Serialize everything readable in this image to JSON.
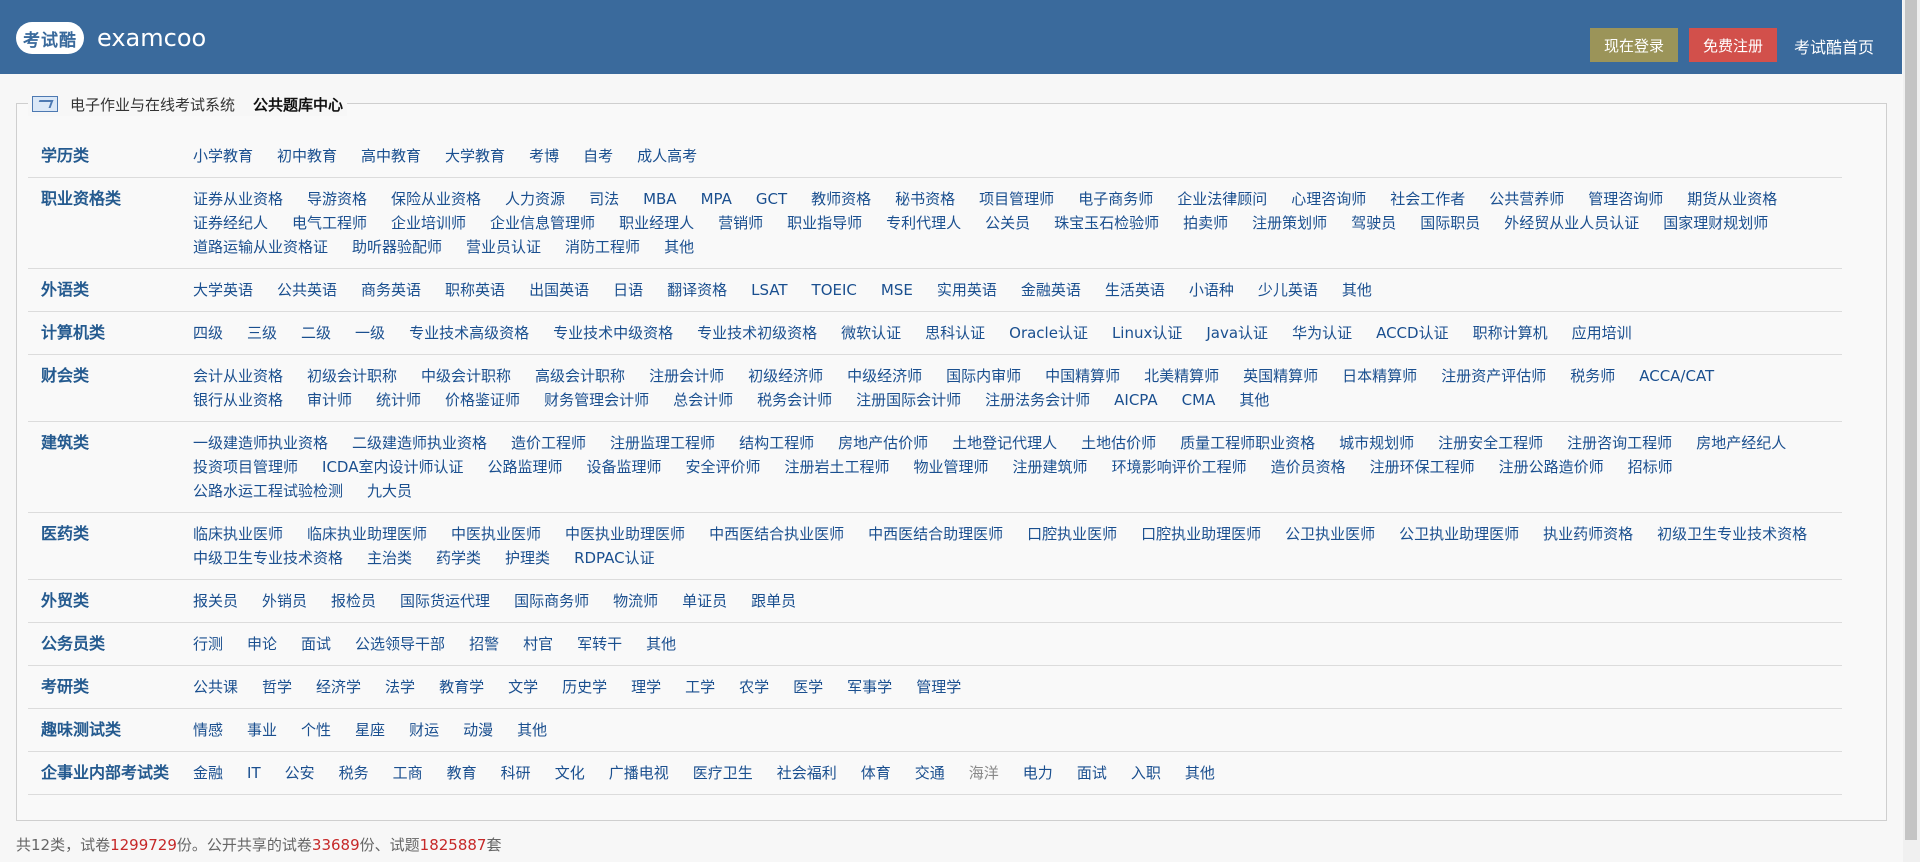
{
  "header": {
    "logo_badge": "考试酷",
    "logo_text": "examcoo",
    "login_label": "现在登录",
    "register_label": "免费注册",
    "home_label": "考试酷首页"
  },
  "legend": {
    "system_link": "电子作业与在线考试系统",
    "title": "公共题库中心"
  },
  "categories": [
    {
      "label": "学历类",
      "items": [
        "小学教育",
        "初中教育",
        "高中教育",
        "大学教育",
        "考博",
        "自考",
        "成人高考"
      ]
    },
    {
      "label": "职业资格类",
      "items": [
        "证券从业资格",
        "导游资格",
        "保险从业资格",
        "人力资源",
        "司法",
        "MBA",
        "MPA",
        "GCT",
        "教师资格",
        "秘书资格",
        "项目管理师",
        "电子商务师",
        "企业法律顾问",
        "心理咨询师",
        "社会工作者",
        "公共营养师",
        "管理咨询师",
        "期货从业资格",
        "证券经纪人",
        "电气工程师",
        "企业培训师",
        "企业信息管理师",
        "职业经理人",
        "营销师",
        "职业指导师",
        "专利代理人",
        "公关员",
        "珠宝玉石检验师",
        "拍卖师",
        "注册策划师",
        "驾驶员",
        "国际职员",
        "外经贸从业人员认证",
        "国家理财规划师",
        "道路运输从业资格证",
        "助听器验配师",
        "营业员认证",
        "消防工程师",
        "其他"
      ]
    },
    {
      "label": "外语类",
      "items": [
        "大学英语",
        "公共英语",
        "商务英语",
        "职称英语",
        "出国英语",
        "日语",
        "翻译资格",
        "LSAT",
        "TOEIC",
        "MSE",
        "实用英语",
        "金融英语",
        "生活英语",
        "小语种",
        "少儿英语",
        "其他"
      ]
    },
    {
      "label": "计算机类",
      "items": [
        "四级",
        "三级",
        "二级",
        "一级",
        "专业技术高级资格",
        "专业技术中级资格",
        "专业技术初级资格",
        "微软认证",
        "思科认证",
        "Oracle认证",
        "Linux认证",
        "Java认证",
        "华为认证",
        "ACCD认证",
        "职称计算机",
        "应用培训"
      ]
    },
    {
      "label": "财会类",
      "items": [
        "会计从业资格",
        "初级会计职称",
        "中级会计职称",
        "高级会计职称",
        "注册会计师",
        "初级经济师",
        "中级经济师",
        "国际内审师",
        "中国精算师",
        "北美精算师",
        "英国精算师",
        "日本精算师",
        "注册资产评估师",
        "税务师",
        "ACCA/CAT",
        "银行从业资格",
        "审计师",
        "统计师",
        "价格鉴证师",
        "财务管理会计师",
        "总会计师",
        "税务会计师",
        "注册国际会计师",
        "注册法务会计师",
        "AICPA",
        "CMA",
        "其他"
      ]
    },
    {
      "label": "建筑类",
      "items": [
        "一级建造师执业资格",
        "二级建造师执业资格",
        "造价工程师",
        "注册监理工程师",
        "结构工程师",
        "房地产估价师",
        "土地登记代理人",
        "土地估价师",
        "质量工程师职业资格",
        "城市规划师",
        "注册安全工程师",
        "注册咨询工程师",
        "房地产经纪人",
        "投资项目管理师",
        "ICDA室内设计师认证",
        "公路监理师",
        "设备监理师",
        "安全评价师",
        "注册岩土工程师",
        "物业管理师",
        "注册建筑师",
        "环境影响评价工程师",
        "造价员资格",
        "注册环保工程师",
        "注册公路造价师",
        "招标师",
        "公路水运工程试验检测",
        "九大员"
      ]
    },
    {
      "label": "医药类",
      "items": [
        "临床执业医师",
        "临床执业助理医师",
        "中医执业医师",
        "中医执业助理医师",
        "中西医结合执业医师",
        "中西医结合助理医师",
        "口腔执业医师",
        "口腔执业助理医师",
        "公卫执业医师",
        "公卫执业助理医师",
        "执业药师资格",
        "初级卫生专业技术资格",
        "中级卫生专业技术资格",
        "主治类",
        "药学类",
        "护理类",
        "RDPAC认证"
      ]
    },
    {
      "label": "外贸类",
      "items": [
        "报关员",
        "外销员",
        "报检员",
        "国际货运代理",
        "国际商务师",
        "物流师",
        "单证员",
        "跟单员"
      ]
    },
    {
      "label": "公务员类",
      "items": [
        "行测",
        "申论",
        "面试",
        "公选领导干部",
        "招警",
        "村官",
        "军转干",
        "其他"
      ]
    },
    {
      "label": "考研类",
      "items": [
        "公共课",
        "哲学",
        "经济学",
        "法学",
        "教育学",
        "文学",
        "历史学",
        "理学",
        "工学",
        "农学",
        "医学",
        "军事学",
        "管理学"
      ]
    },
    {
      "label": "趣味测试类",
      "items": [
        "情感",
        "事业",
        "个性",
        "星座",
        "财运",
        "动漫",
        "其他"
      ]
    },
    {
      "label": "企事业内部考试类",
      "items": [
        "金融",
        "IT",
        "公安",
        "税务",
        "工商",
        "教育",
        "科研",
        "文化",
        "广播电视",
        "医疗卫生",
        "社会福利",
        "体育",
        "交通",
        "海洋",
        "电力",
        "面试",
        "入职",
        "其他"
      ]
    }
  ],
  "footer": {
    "prefix": "共12类，试卷",
    "papers": "1299729",
    "mid": "份。公开共享的试卷",
    "shared": "33689",
    "mid2": "份、试题",
    "questions": "1825887",
    "suffix": "套"
  },
  "colors": {
    "header_bg": "#3a6a9c",
    "login_btn": "#9b9459",
    "register_btn": "#d2504b",
    "category_label": "#245a8f",
    "link": "#1a4f8f",
    "count_red": "#c62828"
  }
}
